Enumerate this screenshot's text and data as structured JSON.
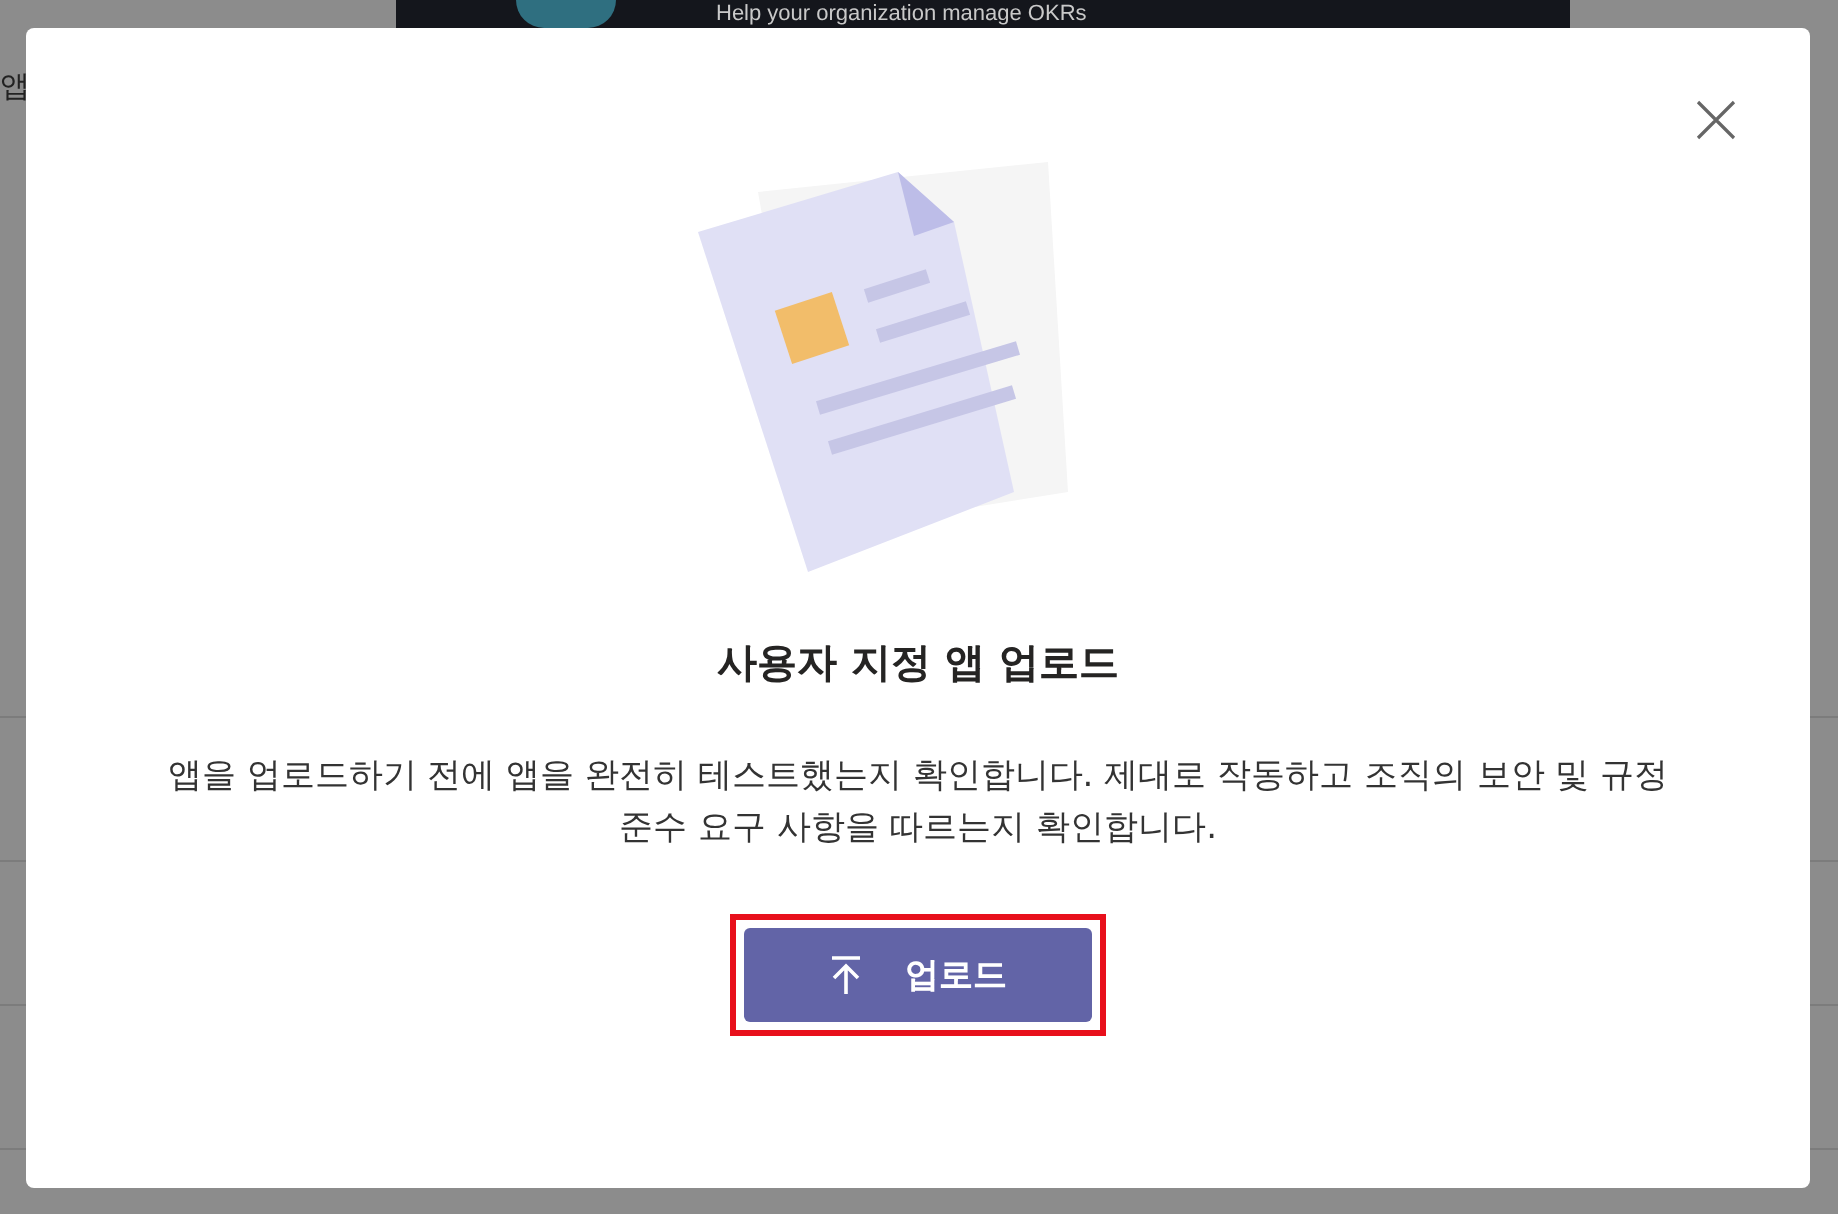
{
  "background": {
    "banner_text": "Help your organization manage OKRs",
    "side_label": "앱"
  },
  "dialog": {
    "title": "사용자 지정 앱 업로드",
    "message": "앱을 업로드하기 전에 앱을 완전히 테스트했는지 확인합니다. 제대로 작동하고 조직의 보안 및 규정 준수 요구 사항을 따르는지 확인합니다.",
    "button": {
      "label": "업로드",
      "highlighted": true
    }
  }
}
